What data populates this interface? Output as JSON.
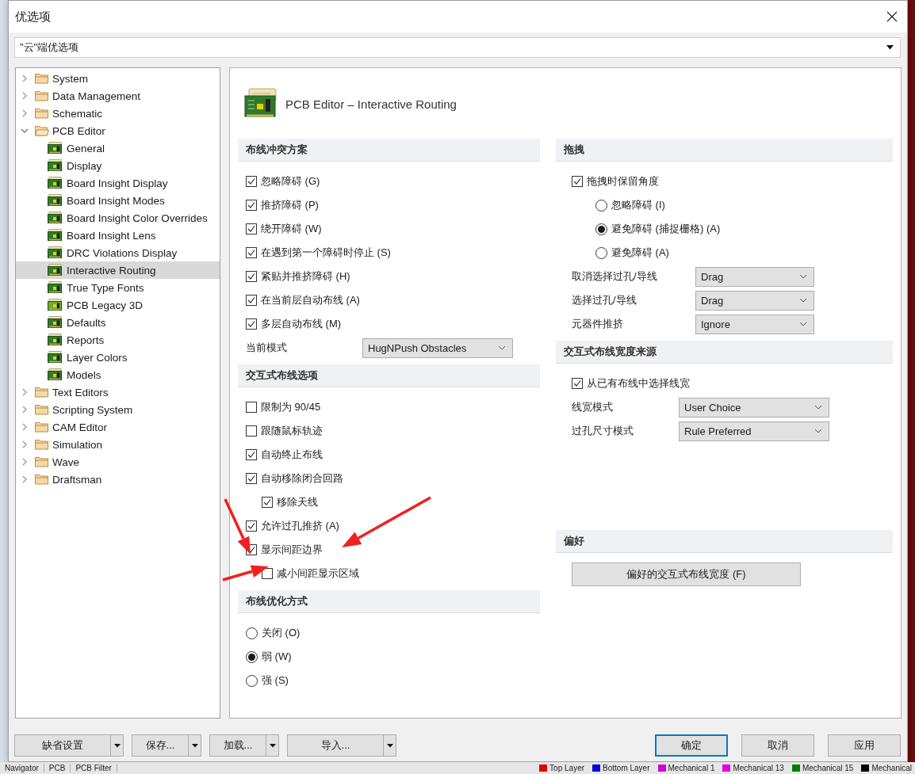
{
  "window": {
    "title": "优选项"
  },
  "preset": {
    "value": "\"云\"端优选项"
  },
  "tree": [
    {
      "label": "System",
      "kind": "folder",
      "expanded": false,
      "selected": false
    },
    {
      "label": "Data Management",
      "kind": "folder",
      "expanded": false,
      "selected": false
    },
    {
      "label": "Schematic",
      "kind": "folder",
      "expanded": false,
      "selected": false
    },
    {
      "label": "PCB Editor",
      "kind": "folder",
      "expanded": true,
      "selected": false,
      "children": [
        {
          "label": "General",
          "kind": "page",
          "selected": false
        },
        {
          "label": "Display",
          "kind": "page",
          "selected": false
        },
        {
          "label": "Board Insight Display",
          "kind": "page",
          "selected": false
        },
        {
          "label": "Board Insight Modes",
          "kind": "page",
          "selected": false
        },
        {
          "label": "Board Insight Color Overrides",
          "kind": "page",
          "selected": false
        },
        {
          "label": "Board Insight Lens",
          "kind": "page",
          "selected": false
        },
        {
          "label": "DRC Violations Display",
          "kind": "page",
          "selected": false
        },
        {
          "label": "Interactive Routing",
          "kind": "page",
          "selected": true
        },
        {
          "label": "True Type Fonts",
          "kind": "page",
          "selected": false
        },
        {
          "label": "PCB Legacy 3D",
          "kind": "page3d",
          "selected": false
        },
        {
          "label": "Defaults",
          "kind": "page",
          "selected": false
        },
        {
          "label": "Reports",
          "kind": "page",
          "selected": false
        },
        {
          "label": "Layer Colors",
          "kind": "page",
          "selected": false
        },
        {
          "label": "Models",
          "kind": "page",
          "selected": false
        }
      ]
    },
    {
      "label": "Text Editors",
      "kind": "folder",
      "expanded": false,
      "selected": false
    },
    {
      "label": "Scripting System",
      "kind": "folder",
      "expanded": false,
      "selected": false
    },
    {
      "label": "CAM Editor",
      "kind": "folder",
      "expanded": false,
      "selected": false
    },
    {
      "label": "Simulation",
      "kind": "folder",
      "expanded": false,
      "selected": false
    },
    {
      "label": "Wave",
      "kind": "folder",
      "expanded": false,
      "selected": false
    },
    {
      "label": "Draftsman",
      "kind": "folder",
      "expanded": false,
      "selected": false
    }
  ],
  "page": {
    "title": "PCB Editor – Interactive Routing"
  },
  "left_sections": [
    {
      "title": "布线冲突方案",
      "items": [
        {
          "kind": "checkbox",
          "label": "忽略障碍 (G)",
          "checked": true
        },
        {
          "kind": "checkbox",
          "label": "推挤障碍 (P)",
          "checked": true
        },
        {
          "kind": "checkbox",
          "label": "绕开障碍 (W)",
          "checked": true
        },
        {
          "kind": "checkbox",
          "label": "在遇到第一个障碍时停止 (S)",
          "checked": true
        },
        {
          "kind": "checkbox",
          "label": "紧贴并推挤障碍 (H)",
          "checked": true
        },
        {
          "kind": "checkbox",
          "label": "在当前层自动布线 (A)",
          "checked": true
        },
        {
          "kind": "checkbox",
          "label": "多层自动布线 (M)",
          "checked": true
        },
        {
          "kind": "dropdown",
          "label": "当前模式",
          "value": "HugNPush Obstacles"
        }
      ]
    },
    {
      "title": "交互式布线选项",
      "items": [
        {
          "kind": "checkbox",
          "label": "限制为 90/45",
          "checked": false
        },
        {
          "kind": "checkbox",
          "label": "跟随鼠标轨迹",
          "checked": false
        },
        {
          "kind": "checkbox",
          "label": "自动终止布线",
          "checked": true
        },
        {
          "kind": "checkbox",
          "label": "自动移除闭合回路",
          "checked": true,
          "children": [
            {
              "kind": "checkbox",
              "label": "移除天线",
              "checked": true
            }
          ]
        },
        {
          "kind": "checkbox",
          "label": "允许过孔推挤 (A)",
          "checked": true
        },
        {
          "kind": "checkbox",
          "label": "显示间距边界",
          "checked": true,
          "children": [
            {
              "kind": "checkbox",
              "label": "减小间距显示区域",
              "checked": false
            }
          ]
        }
      ]
    },
    {
      "title": "布线优化方式",
      "items": [
        {
          "kind": "radio",
          "label": "关闭 (O)",
          "selected": false
        },
        {
          "kind": "radio",
          "label": "弱 (W)",
          "selected": true
        },
        {
          "kind": "radio",
          "label": "强 (S)",
          "selected": false
        }
      ]
    }
  ],
  "right_sections": [
    {
      "title": "拖拽",
      "items": [
        {
          "kind": "checkbox",
          "label": "拖拽时保留角度",
          "checked": true,
          "children": [
            {
              "kind": "radio",
              "label": "忽略障碍 (I)",
              "selected": false
            },
            {
              "kind": "radio",
              "label": "避免障碍 (捕捉栅格) (A)",
              "selected": true
            },
            {
              "kind": "radio",
              "label": "避免障碍 (A)",
              "selected": false
            }
          ]
        },
        {
          "kind": "dropdown",
          "label": "取消选择过孔/导线",
          "value": "Drag"
        },
        {
          "kind": "dropdown",
          "label": "选择过孔/导线",
          "value": "Drag"
        },
        {
          "kind": "dropdown",
          "label": "元器件推挤",
          "value": "Ignore"
        }
      ]
    },
    {
      "title": "交互式布线宽度来源",
      "items": [
        {
          "kind": "checkbox",
          "label": "从已有布线中选择线宽",
          "checked": true
        },
        {
          "kind": "dropdown",
          "label": "线宽模式",
          "value": "User Choice"
        },
        {
          "kind": "dropdown",
          "label": "过孔尺寸模式",
          "value": "Rule Preferred"
        }
      ]
    },
    {
      "title": "偏好",
      "items": [
        {
          "kind": "button",
          "label": "偏好的交互式布线宽度 (F)"
        }
      ]
    }
  ],
  "footer_left": [
    "缺省设置",
    "保存...",
    "加载...",
    "导入..."
  ],
  "footer_right": [
    {
      "label": "确定",
      "default": true
    },
    {
      "label": "取消",
      "default": false
    },
    {
      "label": "应用",
      "default": false
    }
  ],
  "background_tabs": [
    "Navigator",
    "PCB",
    "PCB Filter"
  ],
  "background_layers": [
    {
      "label": "Top Layer",
      "color": "#e00000"
    },
    {
      "label": "Bottom Layer",
      "color": "#0000e0"
    },
    {
      "label": "Mechanical 1",
      "color": "#d000d0"
    },
    {
      "label": "Mechanical 13",
      "color": "#e000e0"
    },
    {
      "label": "Mechanical 15",
      "color": "#008000"
    },
    {
      "label": "Mechanical",
      "color": "#000000"
    }
  ]
}
